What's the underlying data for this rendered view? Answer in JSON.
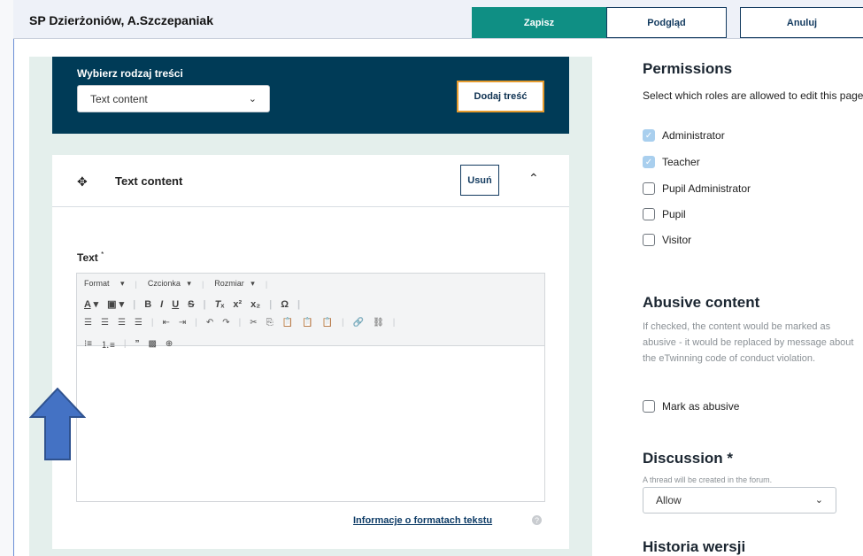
{
  "header": {
    "title": "SP Dzierżoniów, A.Szczepaniak",
    "save_label": "Zapisz",
    "preview_label": "Podgląd",
    "cancel_label": "Anuluj"
  },
  "chooser": {
    "label": "Wybierz rodzaj treści",
    "select_value": "Text content",
    "add_label": "Dodaj treść"
  },
  "content_card": {
    "title": "Text content",
    "delete_label": "Usuń",
    "text_label": "Text",
    "required_mark": "*",
    "toolbar": {
      "format": "Format",
      "font": "Czcionka",
      "size": "Rozmiar"
    },
    "formats_link": "Informacje o formatach tekstu"
  },
  "permissions": {
    "heading": "Permissions",
    "description": "Select which roles are allowed to edit this page",
    "roles": [
      {
        "label": "Administrator",
        "checked": true
      },
      {
        "label": "Teacher",
        "checked": true
      },
      {
        "label": "Pupil Administrator",
        "checked": false
      },
      {
        "label": "Pupil",
        "checked": false
      },
      {
        "label": "Visitor",
        "checked": false
      }
    ]
  },
  "abusive": {
    "heading": "Abusive content",
    "description": "If checked, the content would be marked as abusive - it would be replaced by message about the eTwinning code of conduct violation.",
    "checkbox_label": "Mark as abusive"
  },
  "discussion": {
    "heading": "Discussion *",
    "hint": "A thread will be created in the forum.",
    "select_value": "Allow"
  },
  "history": {
    "heading": "Historia wersji"
  },
  "colors": {
    "save": "#0f8f84",
    "panel_dark": "#003b57",
    "accent_orange": "#e59b2e",
    "left_bg": "#e4efec",
    "arrow": "#4472c4"
  }
}
